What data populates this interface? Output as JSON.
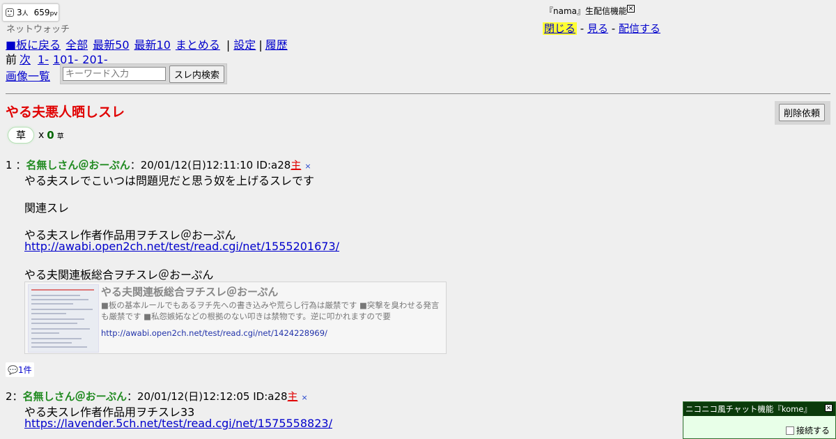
{
  "counter": {
    "people": "3",
    "people_unit": "人",
    "pv": "659",
    "pv_unit": "pv"
  },
  "site_label": "ネットウォッチ",
  "nav": {
    "back": "■板に戻る",
    "all": "全部",
    "latest50": "最新50",
    "latest10": "最新10",
    "summary": "まとめる",
    "sep": "|",
    "settings": "設定",
    "history": "履歴"
  },
  "pager": {
    "prev": "前",
    "next": "次",
    "p1": "1-",
    "p101": "101-",
    "p201": "201-"
  },
  "image_list": "画像一覧",
  "search": {
    "placeholder": "キーワード入力",
    "button": "スレ内検索"
  },
  "nama": {
    "title": "『nama』生配信機能",
    "close_x": "×",
    "close": "閉じる",
    "dash1": "-",
    "watch": "見る",
    "dash2": "-",
    "broadcast": "配信する"
  },
  "thread": {
    "title": "やる夫悪人晒しスレ",
    "delete_request": "削除依頼"
  },
  "kusa": {
    "button": "草",
    "x": "x",
    "count": "0",
    "unit": "草"
  },
  "posts": [
    {
      "num": "1",
      "sep": "：",
      "name": "名無しさん＠おーぷん",
      "colon": "：",
      "date": "20/01/12(日)12:11:10",
      "id": "ID:a28",
      "owner": "主",
      "del": "×",
      "lines": [
        "やる夫スレでこいつは問題児だと思う奴を上げるスレです",
        "関連スレ",
        "やる夫スレ作者作品用ヲチスレ＠おーぷん",
        "やる夫関連板総合ヲチスレ＠おーぷん"
      ],
      "link1": "http://awabi.open2ch.net/test/read.cgi/net/1555201673/",
      "card": {
        "title": "やる夫関連板総合ヲチスレ＠おーぷん",
        "desc": "■板の基本ルールでもあるヲチ先への書き込みや荒らし行為は厳禁です ■突撃を臭わせる発言も厳禁です ■私怨嫉妬などの根拠のない叩きは禁物です。逆に叩かれますので要",
        "url": "http://awabi.open2ch.net/test/read.cgi/net/1424228969/"
      },
      "reply_count": "1件"
    },
    {
      "num": "2",
      "name": "名無しさん＠おーぷん",
      "colon": "：",
      "date": "20/01/12(日)12:12:05",
      "id": "ID:a28",
      "owner": "主",
      "del": "×",
      "lines": [
        "やる夫スレ作者作品用ヲチスレ33"
      ],
      "link1": "https://lavender.5ch.net/test/read.cgi/net/1575558823/"
    }
  ],
  "chat": {
    "title": "ニコニコ風チャット機能『kome』",
    "close_x": "×",
    "connect": "接続する"
  },
  "colors": {
    "title_red": "#e00000",
    "name_green": "#228b22",
    "link_blue": "#0000cc",
    "chat_head": "#0a3a0a"
  },
  "icons": [
    "face-icon",
    "speech-bubble-icon",
    "close-box-icon",
    "checkbox-icon"
  ]
}
